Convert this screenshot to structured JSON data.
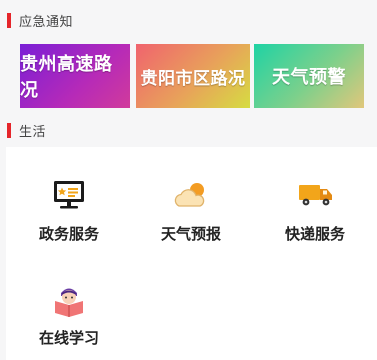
{
  "emergency": {
    "title": "应急通知",
    "banners": [
      {
        "label": "贵州高速路况"
      },
      {
        "label": "贵阳市区路况"
      },
      {
        "label": "天气预警"
      }
    ]
  },
  "life": {
    "title": "生活",
    "services": [
      {
        "label": "政务服务",
        "icon": "monitor-icon"
      },
      {
        "label": "天气预报",
        "icon": "weather-icon"
      },
      {
        "label": "快递服务",
        "icon": "delivery-truck-icon"
      },
      {
        "label": "在线学习",
        "icon": "reading-student-icon"
      }
    ]
  },
  "colors": {
    "accent": "#e5252a"
  }
}
